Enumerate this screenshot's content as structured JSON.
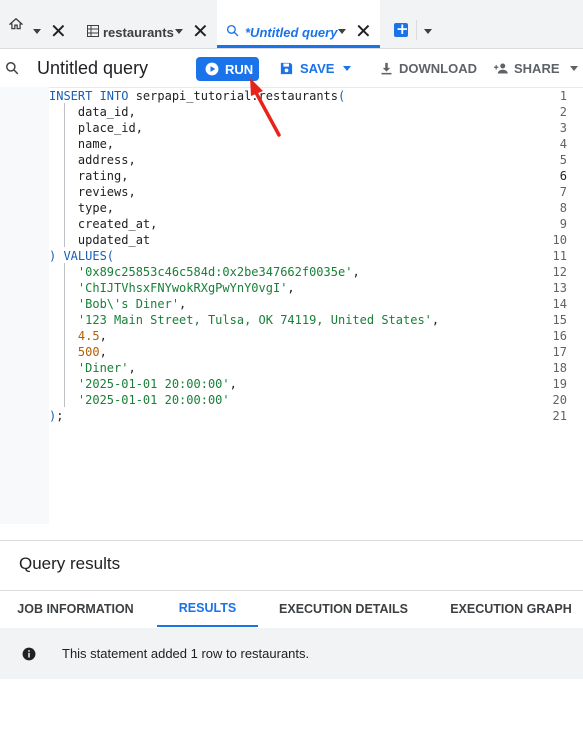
{
  "tabs": {
    "restaurants_label": "restaurants",
    "query_label": "*Untitled query"
  },
  "toolbar": {
    "title": "Untitled query",
    "run_label": "RUN",
    "save_label": "SAVE",
    "download_label": "DOWNLOAD",
    "share_label": "SHARE"
  },
  "editor": {
    "line_numbers": [
      "1",
      "2",
      "3",
      "4",
      "5",
      "6",
      "7",
      "8",
      "9",
      "10",
      "11",
      "12",
      "13",
      "14",
      "15",
      "16",
      "17",
      "18",
      "19",
      "20",
      "21"
    ],
    "lines": [
      {
        "parts": [
          {
            "c": "kw",
            "t": "INSERT INTO"
          },
          {
            "c": "pl",
            "t": " serpapi_tutorial.restaurants"
          },
          {
            "c": "kw",
            "t": "("
          }
        ]
      },
      {
        "parts": [
          {
            "c": "pl",
            "t": "    data_id,"
          }
        ]
      },
      {
        "parts": [
          {
            "c": "pl",
            "t": "    place_id,"
          }
        ]
      },
      {
        "parts": [
          {
            "c": "pl",
            "t": "    name,"
          }
        ]
      },
      {
        "parts": [
          {
            "c": "pl",
            "t": "    address,"
          }
        ]
      },
      {
        "parts": [
          {
            "c": "pl",
            "t": "    rating,"
          }
        ]
      },
      {
        "parts": [
          {
            "c": "pl",
            "t": "    reviews,"
          }
        ]
      },
      {
        "parts": [
          {
            "c": "pl",
            "t": "    type,"
          }
        ]
      },
      {
        "parts": [
          {
            "c": "pl",
            "t": "    created_at,"
          }
        ]
      },
      {
        "parts": [
          {
            "c": "pl",
            "t": "    updated_at"
          }
        ]
      },
      {
        "parts": [
          {
            "c": "kw",
            "t": ") VALUES("
          }
        ]
      },
      {
        "parts": [
          {
            "c": "str",
            "t": "    '0x89c25853c46c584d:0x2be347662f0035e'"
          },
          {
            "c": "pl",
            "t": ","
          }
        ]
      },
      {
        "parts": [
          {
            "c": "str",
            "t": "    'ChIJTVhsxFNYwokRXgPwYnY0vgI'"
          },
          {
            "c": "pl",
            "t": ","
          }
        ]
      },
      {
        "parts": [
          {
            "c": "str",
            "t": "    'Bob\\'s Diner'"
          },
          {
            "c": "pl",
            "t": ","
          }
        ]
      },
      {
        "parts": [
          {
            "c": "str",
            "t": "    '123 Main Street, Tulsa, OK 74119, United States'"
          },
          {
            "c": "pl",
            "t": ","
          }
        ]
      },
      {
        "parts": [
          {
            "c": "num",
            "t": "    4.5"
          },
          {
            "c": "pl",
            "t": ","
          }
        ]
      },
      {
        "parts": [
          {
            "c": "num",
            "t": "    500"
          },
          {
            "c": "pl",
            "t": ","
          }
        ]
      },
      {
        "parts": [
          {
            "c": "str",
            "t": "    'Diner'"
          },
          {
            "c": "pl",
            "t": ","
          }
        ]
      },
      {
        "parts": [
          {
            "c": "str",
            "t": "    '2025-01-01 20:00:00'"
          },
          {
            "c": "pl",
            "t": ","
          }
        ]
      },
      {
        "parts": [
          {
            "c": "str",
            "t": "    '2025-01-01 20:00:00'"
          }
        ]
      },
      {
        "parts": [
          {
            "c": "kw",
            "t": ")"
          },
          {
            "c": "pl",
            "t": ";"
          }
        ]
      }
    ]
  },
  "results": {
    "title": "Query results",
    "tabs": [
      "JOB INFORMATION",
      "RESULTS",
      "EXECUTION DETAILS",
      "EXECUTION GRAPH"
    ],
    "message": "This statement added 1 row to restaurants."
  },
  "colors": {
    "accent": "#1a73e8",
    "arrow": "#e8231a"
  }
}
